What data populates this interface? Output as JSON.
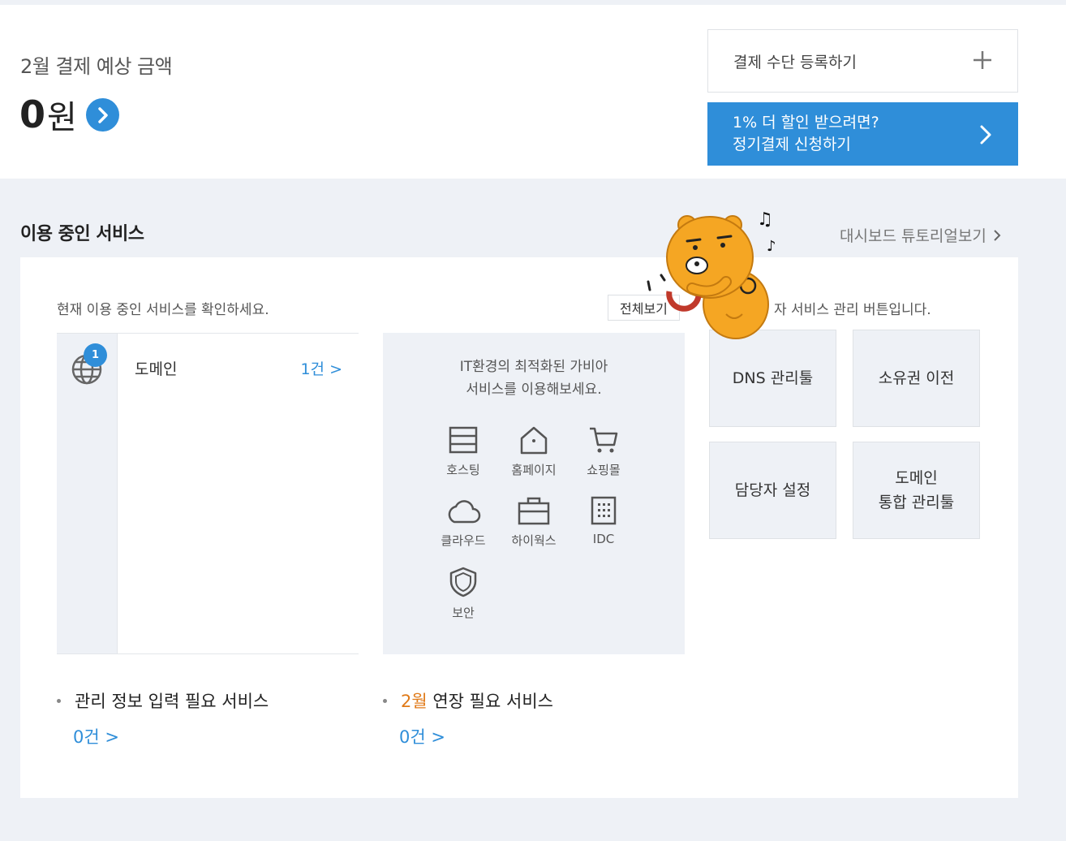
{
  "payment": {
    "title": "2월 결제 예상 금액",
    "amount": "0",
    "unit": "원"
  },
  "register_button": {
    "label": "결제 수단 등록하기"
  },
  "promo_button": {
    "line1": "1% 더 할인 받으려면?",
    "line2": "정기결제 신청하기"
  },
  "section": {
    "title": "이용 중인 서비스",
    "tutorial": "대시보드 튜토리얼보기"
  },
  "panel": {
    "description": "현재 이용 중인 서비스를 확인하세요.",
    "view_all": "전체보기",
    "manager_desc": "자 서비스 관리 버튼입니다."
  },
  "services": [
    {
      "name": "도메인",
      "count": "1건 >",
      "badge": "1"
    }
  ],
  "promo": {
    "line1": "IT환경의 최적화된 가비아",
    "line2": "서비스를 이용해보세요.",
    "items": [
      "호스팅",
      "홈페이지",
      "쇼핑몰",
      "클라우드",
      "하이웍스",
      "IDC",
      "보안"
    ]
  },
  "tools": [
    "DNS 관리툴",
    "소유권 이전",
    "담당자 설정",
    "도메인",
    "통합 관리툴"
  ],
  "needs": {
    "info_label": "관리 정보 입력 필요 서비스",
    "info_count": "0건 >",
    "renew_month": "2월",
    "renew_label": " 연장 필요 서비스",
    "renew_count": "0건 >"
  },
  "colors": {
    "accent": "#2f8ed9",
    "month": "#e07a18",
    "background": "#eef1f6"
  }
}
